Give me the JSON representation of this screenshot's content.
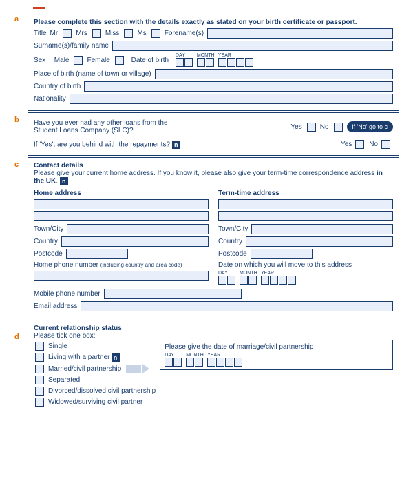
{
  "a": {
    "marker": "a",
    "heading": "Please complete this section with the details exactly as stated on your birth certificate or passport.",
    "title": "Title",
    "mr": "Mr",
    "mrs": "Mrs",
    "miss": "Miss",
    "ms": "Ms",
    "forenames": "Forename(s)",
    "surname": "Surname(s)/family name",
    "sex": "Sex",
    "male": "Male",
    "female": "Female",
    "dob": "Date of birth",
    "day": "DAY",
    "month": "MONTH",
    "year": "YEAR",
    "place": "Place of birth (name of town or village)",
    "country": "Country of birth",
    "nationality": "Nationality"
  },
  "b": {
    "marker": "b",
    "q1a": "Have you ever had any other loans from the",
    "q1b": "Student Loans Company (SLC)?",
    "yes": "Yes",
    "no": "No",
    "hint": "if 'No' go to c",
    "q2": "If 'Yes', are you behind with the repayments?"
  },
  "c": {
    "marker": "c",
    "heading": "Contact details",
    "intro1": "Please give your current home address. If you know it, please also give your term-time correspondence address ",
    "intro2": "in the UK",
    "home": "Home address",
    "term": "Term-time address",
    "town": "Town/City",
    "country": "Country",
    "postcode": "Postcode",
    "homephone": "Home phone number ",
    "homephone2": "(including country and area code)",
    "movedate": "Date on which you will move to this address",
    "day": "DAY",
    "month": "MONTH",
    "year": "YEAR",
    "mobile": "Mobile phone number",
    "email": "Email address"
  },
  "d": {
    "marker": "d",
    "heading": "Current relationship status",
    "tick": "Please tick one box:",
    "o1": "Single",
    "o2": "Living with a partner",
    "o3": "Married/civil partnership",
    "o4": "Separated",
    "o5": "Divorced/dissolved civil partnership",
    "o6": "Widowed/surviving civil partner",
    "mlabel": "Please give the date of marriage/civil partnership",
    "day": "DAY",
    "month": "MONTH",
    "year": "YEAR"
  },
  "icon": "n"
}
